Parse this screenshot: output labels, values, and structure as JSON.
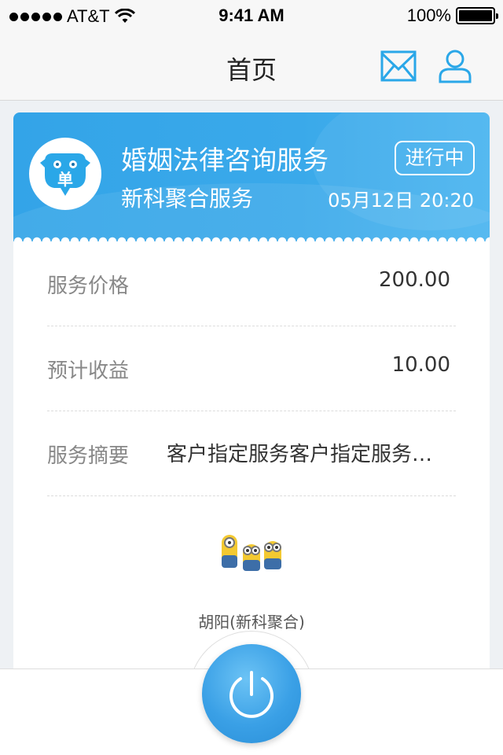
{
  "status_bar": {
    "carrier": "AT&T",
    "time": "9:41 AM",
    "battery": "100%",
    "battery_level": 1.0,
    "icons": [
      "signal-dots-icon",
      "wifi-icon",
      "battery-icon"
    ]
  },
  "nav": {
    "title": "首页",
    "icons": [
      "mail-icon",
      "user-icon"
    ],
    "accent_color": "#2aa7e8"
  },
  "order": {
    "title": "婚姻法律咨询服务",
    "subtitle": "新科聚合服务",
    "status": "进行中",
    "datetime": "05月12日 20:20",
    "logo_text": "单",
    "header_color": "#3aa9ea",
    "rows": [
      {
        "label": "服务价格",
        "value": "200.00"
      },
      {
        "label": "预计收益",
        "value": "10.00"
      },
      {
        "label": "服务摘要",
        "value": "客户指定服务客户指定服务…"
      }
    ],
    "agent": {
      "name": "胡阳(新科聚合)"
    }
  },
  "bottom": {
    "power_icon": "power-icon",
    "button_color": "#3aa0e6"
  }
}
